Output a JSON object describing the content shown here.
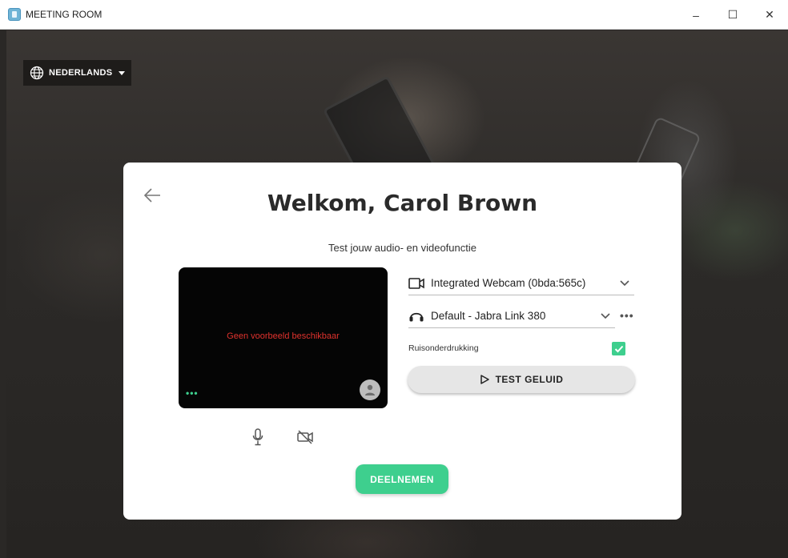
{
  "window": {
    "title": "MEETING ROOM",
    "controls": {
      "minimize": "–",
      "maximize": "☐",
      "close": "✕"
    }
  },
  "language": {
    "label": "NEDERLANDS",
    "icon": "globe-icon"
  },
  "card": {
    "title": "Welkom, Carol Brown",
    "subtitle": "Test jouw audio- en videofunctie",
    "preview": {
      "message": "Geen voorbeeld beschikbaar",
      "dots": "•••"
    },
    "devices": {
      "webcam": {
        "icon": "video-camera-icon",
        "value": "Integrated Webcam (0bda:565c)"
      },
      "audio": {
        "icon": "headset-icon",
        "value": "Default - Jabra Link 380"
      },
      "more": "•••"
    },
    "noise_suppression": {
      "label": "Ruisonderdrukking",
      "checked": true
    },
    "test_sound": {
      "label": "TEST GELUID",
      "icon": "play-icon"
    },
    "join": {
      "label": "DEELNEMEN"
    }
  },
  "colors": {
    "accent": "#3ecf8e",
    "error": "#e0322d",
    "card_bg": "#ffffff"
  }
}
